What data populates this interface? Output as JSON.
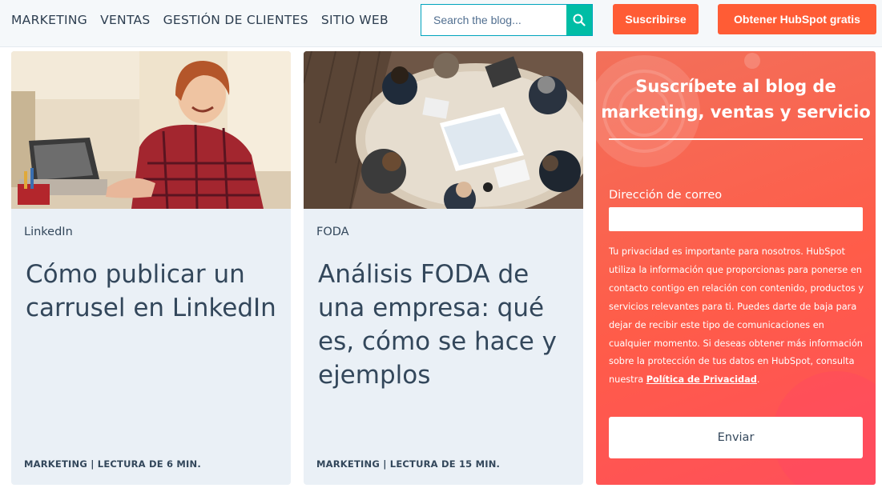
{
  "nav": {
    "items": [
      {
        "label": "MARKETING"
      },
      {
        "label": "VENTAS"
      },
      {
        "label": "GESTIÓN DE CLIENTES"
      },
      {
        "label": "SITIO WEB"
      }
    ]
  },
  "search": {
    "placeholder": "Search the blog..."
  },
  "header": {
    "subscribe_label": "Suscribirse",
    "cta_label": "Obtener HubSpot gratis"
  },
  "cards": [
    {
      "tag": "LinkedIn",
      "title": "Cómo publicar un carrusel en LinkedIn",
      "category": "MARKETING",
      "read_time": "LECTURA DE 6 MIN."
    },
    {
      "tag": "FODA",
      "title": "Análisis FODA de una empresa: qué es, cómo se hace y ejemplos",
      "category": "MARKETING",
      "read_time": "LECTURA DE 15 MIN."
    }
  ],
  "promo": {
    "title": "Suscríbete al blog de marketing, ventas y servicio",
    "email_label": "Dirección de correo",
    "privacy_text": "Tu privacidad es importante para nosotros. HubSpot utiliza la información que proporcionas para ponerse en contacto contigo en relación con contenido, productos y servicios relevantes para ti. Puedes darte de baja para dejar de recibir este tipo de comunicaciones en cualquier momento. Si deseas obtener más información sobre la protección de tus datos en HubSpot, consulta nuestra",
    "privacy_link": "Política de Privacidad",
    "privacy_end": ".",
    "submit_label": "Enviar"
  },
  "colors": {
    "accent_orange": "#ff5c35",
    "search_teal": "#00bda5",
    "card_bg": "#eaf0f6",
    "text_dark": "#33475b"
  },
  "icons": [
    "search-icon"
  ]
}
